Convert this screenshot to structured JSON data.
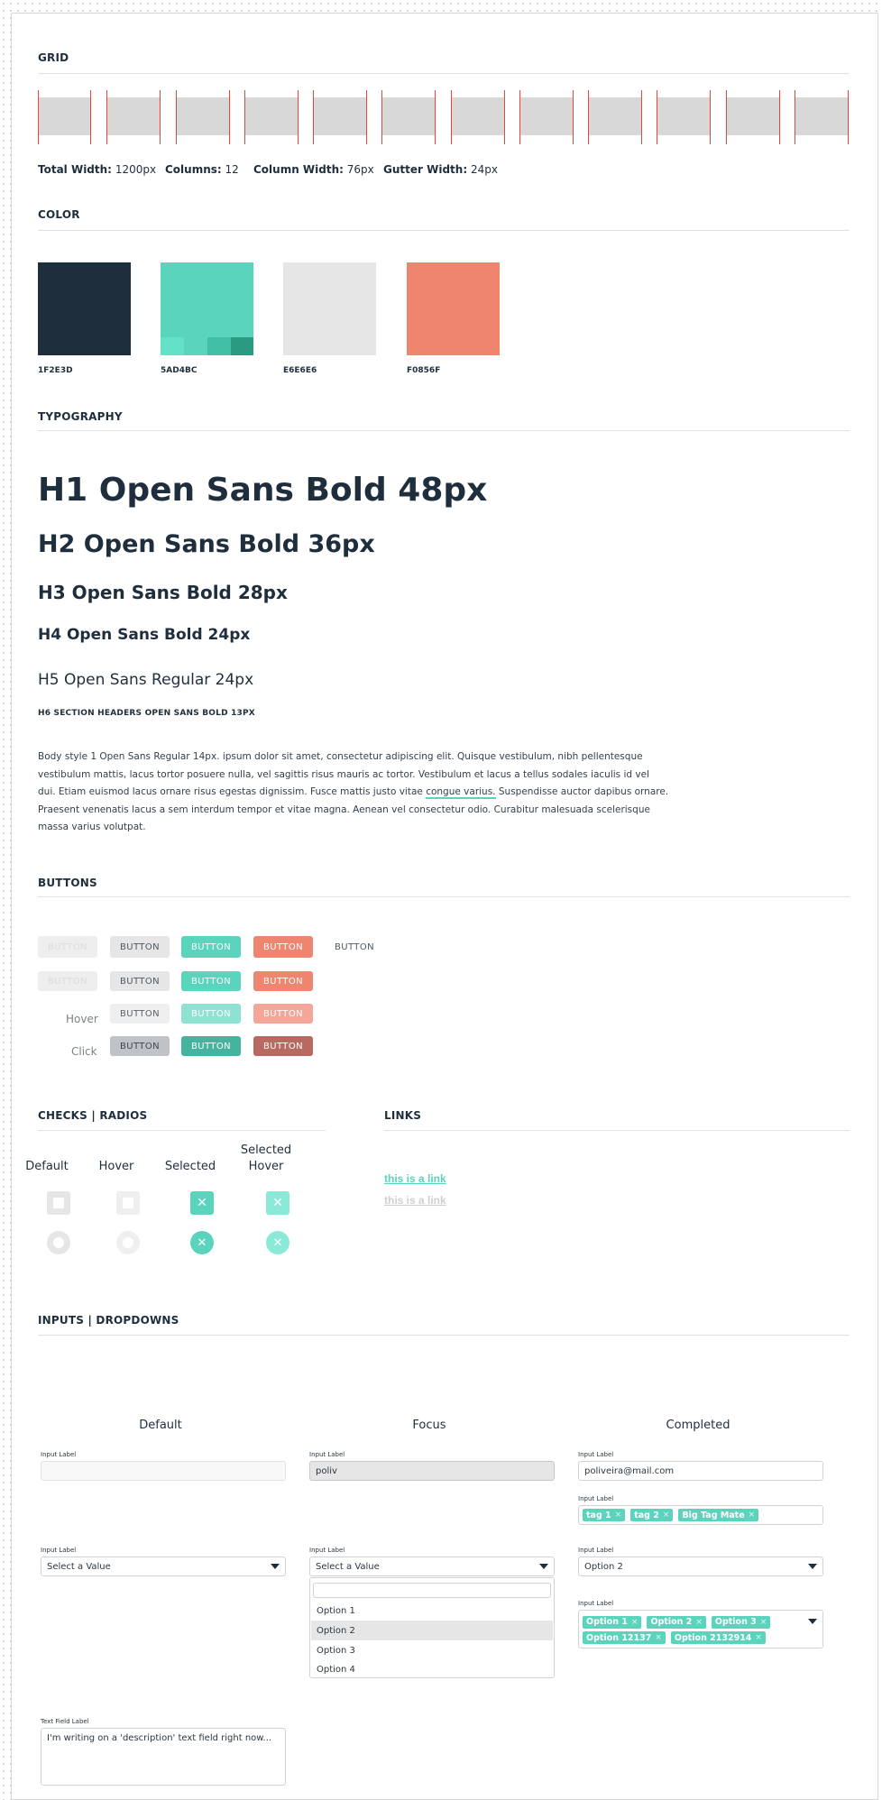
{
  "sections": {
    "grid": "GRID",
    "color": "COLOR",
    "typography": "TYPOGRAPHY",
    "buttons": "BUTTONS",
    "checks": "CHECKS | RADIOS",
    "links": "LINKS",
    "inputs": "INPUTS | DROPDOWNS"
  },
  "grid": {
    "total_label": "Total Width:",
    "total_value": "1200px",
    "columns_label": "Columns:",
    "columns_value": "12",
    "colwidth_label": "Column Width:",
    "colwidth_value": "76px",
    "gutter_label": "Gutter Width:",
    "gutter_value": "24px"
  },
  "colors": [
    {
      "label": "1F2E3D",
      "hex": "#1F2E3D"
    },
    {
      "label": "5AD4BC",
      "hex": "#5AD4BC"
    },
    {
      "label": "E6E6E6",
      "hex": "#E6E6E6"
    },
    {
      "label": "F0856F",
      "hex": "#F0856F"
    }
  ],
  "typography": {
    "h1": "H1 Open Sans Bold 48px",
    "h2": "H2 Open Sans Bold 36px",
    "h3": "H3 Open Sans Bold 28px",
    "h4": "H4 Open Sans Bold 24px",
    "h5": "H5 Open Sans Regular 24px",
    "h6": "H6 SECTION HEADERS OPEN SANS BOLD 13PX",
    "body_before": "Body style 1 Open Sans Regular 14px. ipsum dolor sit amet, consectetur adipiscing elit. Quisque vestibulum, nibh pellentesque vestibulum mattis, lacus tortor posuere nulla, vel sagittis risus mauris ac tortor. Vestibulum et lacus a tellus sodales iaculis id vel dui. Etiam euismod lacus ornare risus egestas dignissim. Fusce mattis justo vitae ",
    "body_link": "congue varius.",
    "body_after": " Suspendisse auctor dapibus ornare. Praesent venenatis lacus a sem interdum tempor et vitae magna. Aenean vel consectetur odio. Curabitur malesuada scelerisque massa varius volutpat."
  },
  "buttons": {
    "label": "BUTTON",
    "hover": "Hover",
    "click": "Click"
  },
  "checks": {
    "default": "Default",
    "hover": "Hover",
    "selected": "Selected",
    "selected_hover_1": "Selected",
    "selected_hover_2": "Hover",
    "x_glyph": "✕"
  },
  "links": {
    "active": "this is a link",
    "visited": "this is a link"
  },
  "inputs": {
    "col_default": "Default",
    "col_focus": "Focus",
    "col_completed": "Completed",
    "input_label": "Input Label",
    "focus_value": "poliv",
    "email_value": "poliveira@mail.com",
    "tags": [
      "tag 1",
      "tag 2",
      "Big Tag Mate"
    ],
    "select_placeholder": "Select a Value",
    "select_completed": "Option 2",
    "options": [
      "Option 1",
      "Option 2",
      "Option 3",
      "Option 4"
    ],
    "multi_tags_row1": [
      "Option 1",
      "Option 2",
      "Option 3"
    ],
    "multi_tags_row2": [
      "Option 12137",
      "Option 2132914"
    ],
    "remove_glyph": "×",
    "textfield_label": "Text Field Label",
    "textfield_value": "I'm writing on a 'description' text field right now..."
  }
}
